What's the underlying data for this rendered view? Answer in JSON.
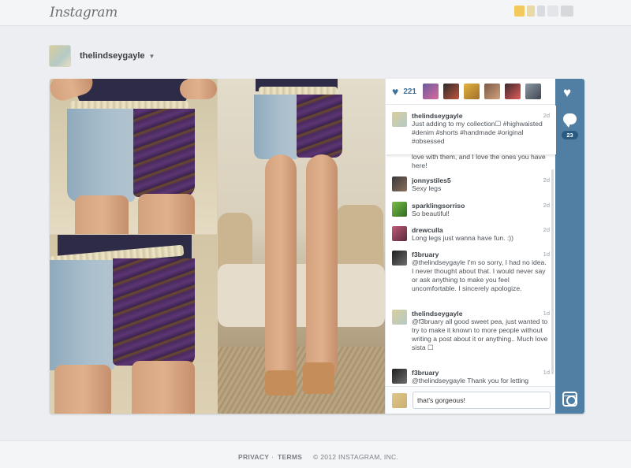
{
  "header": {
    "logo_text": "Instagram"
  },
  "profile": {
    "username": "thelindseygayle",
    "caret": "▼"
  },
  "post": {
    "likes_count": "221",
    "caption": {
      "user": "thelindseygayle",
      "text": "Just adding to my collection☐ #highwaisted #denim #shorts #handmade #original #obsessed",
      "time": "2d"
    },
    "partial_comment_text": "love with them, and I love the ones you have here!",
    "comments": [
      {
        "user": "jonnystiles5",
        "text": "Sexy legs",
        "time": "2d"
      },
      {
        "user": "sparklingsorriso",
        "text": "So beautiful!",
        "time": "2d"
      },
      {
        "user": "drewculla",
        "text": "Long legs just wanna have fun. :))",
        "time": "2d"
      },
      {
        "user": "f3bruary",
        "text": "@thelindseygayle I'm so sorry, I had no idea. I never thought about that. I would never say or ask anything to make you feel uncomfortable. I sincerely apologize.",
        "time": "1d"
      },
      {
        "user": "thelindseygayle",
        "text": "@f3bruary all good sweet pea, just wanted to try to make it known to more people without writing a post about it or anything.. Much love sista ☐",
        "time": "1d"
      },
      {
        "user": "f3bruary",
        "text": "@thelindseygayle Thank you for letting",
        "time": "1d"
      }
    ],
    "comment_input_value": "that's gorgeous!",
    "comment_count": "23"
  },
  "footer": {
    "privacy": "PRIVACY",
    "separator": "·",
    "terms": "TERMS",
    "copyright": "© 2012 INSTAGRAM, INC."
  },
  "colors": {
    "accent": "#3f729b",
    "action_bar": "#517fa4",
    "page_bg": "#eceef1"
  },
  "icons": [
    "heart-icon",
    "comment-icon",
    "camera-icon",
    "chevron-down-icon"
  ]
}
